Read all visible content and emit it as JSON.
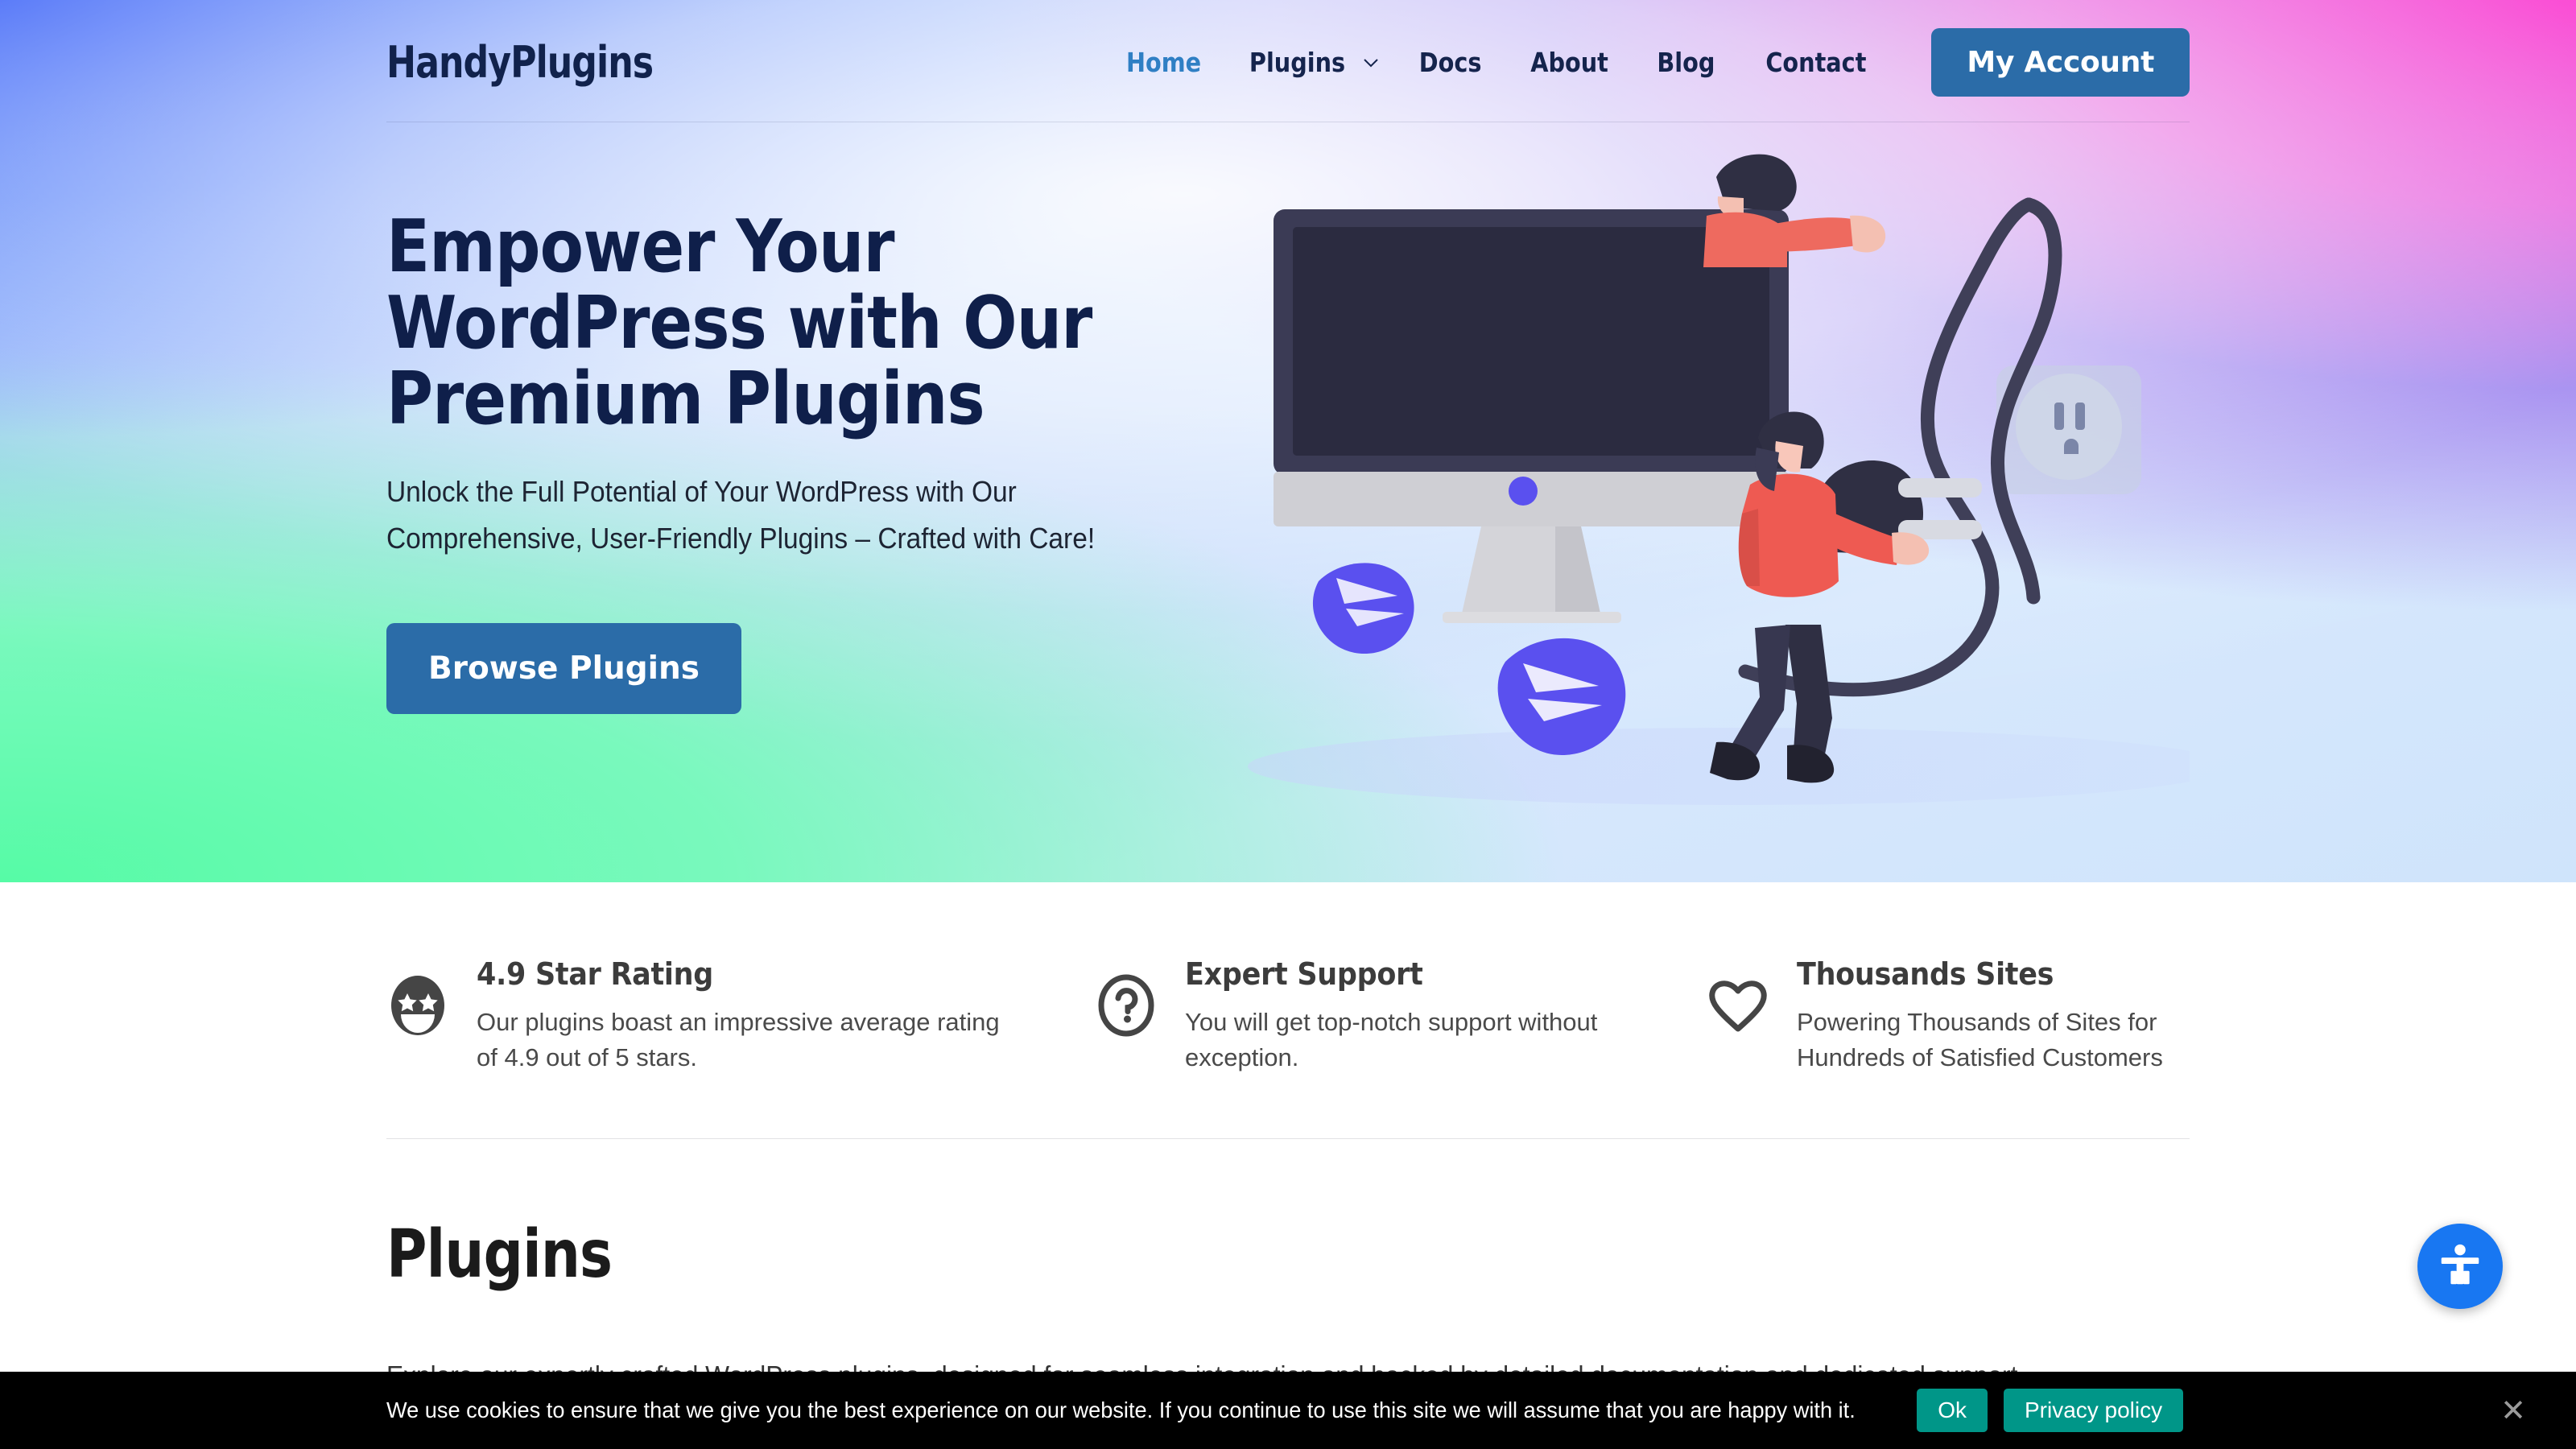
{
  "header": {
    "logo": "HandyPlugins",
    "nav": [
      {
        "label": "Home",
        "active": true,
        "dropdown": false
      },
      {
        "label": "Plugins",
        "active": false,
        "dropdown": true
      },
      {
        "label": "Docs",
        "active": false,
        "dropdown": false
      },
      {
        "label": "About",
        "active": false,
        "dropdown": false
      },
      {
        "label": "Blog",
        "active": false,
        "dropdown": false
      },
      {
        "label": "Contact",
        "active": false,
        "dropdown": false
      }
    ],
    "account_button": "My Account",
    "accent_color": "#2b6ca8",
    "active_link_color": "#2f7fc4"
  },
  "hero": {
    "title": "Empower Your WordPress with Our Premium Plugins",
    "subtitle": "Unlock the Full Potential of Your WordPress with Our Comprehensive, User-Friendly Plugins – Crafted with Care!",
    "cta_label": "Browse Plugins"
  },
  "features": [
    {
      "icon": "star-eyes-smiley-icon",
      "title": "4.9 Star Rating",
      "desc": "Our plugins boast an impressive average rating of 4.9 out of 5 stars."
    },
    {
      "icon": "question-mark-icon",
      "title": "Expert Support",
      "desc": "You will get top-notch support without exception."
    },
    {
      "icon": "heart-icon",
      "title": "Thousands Sites",
      "desc": "Powering Thousands of Sites for Hundreds of Satisfied Customers"
    }
  ],
  "plugins_section": {
    "title": "Plugins",
    "description": "Explore our expertly crafted WordPress plugins, designed for seamless integration and backed by detailed documentation and dedicated support."
  },
  "accessibility": {
    "icon": "accessibility-person-icon",
    "color": "#1877f2"
  },
  "cookie_notice": {
    "message": "We use cookies to ensure that we give you the best experience on our website. If you continue to use this site we will assume that you are happy with it.",
    "ok_label": "Ok",
    "privacy_label": "Privacy policy",
    "close_label": "✕",
    "button_color": "#009688"
  }
}
